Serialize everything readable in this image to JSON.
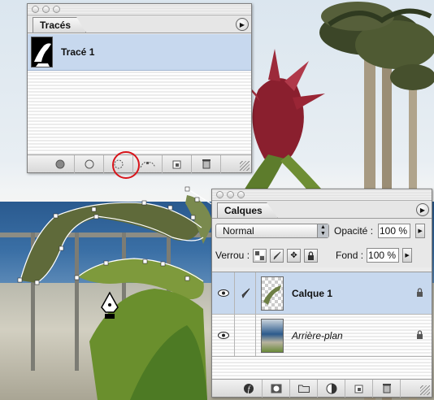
{
  "paths_panel": {
    "tab": "Tracés",
    "items": [
      {
        "label": "Tracé 1"
      }
    ],
    "buttons": [
      "fill-path-icon",
      "stroke-path-icon",
      "load-path-as-selection-icon",
      "make-work-path-icon",
      "new-path-icon",
      "trash-icon"
    ]
  },
  "layers_panel": {
    "tab": "Calques",
    "blend_mode": "Normal",
    "opacity_label": "Opacité :",
    "opacity_value": "100 %",
    "lock_label": "Verrou :",
    "fill_label": "Fond :",
    "fill_value": "100 %",
    "layers": [
      {
        "name": "Calque 1",
        "selected": true
      },
      {
        "name": "Arrière-plan",
        "selected": false
      }
    ],
    "buttons": [
      "layer-style-icon",
      "add-mask-icon",
      "new-group-icon",
      "adjustment-layer-icon",
      "new-layer-icon",
      "trash-icon"
    ]
  },
  "colors": {
    "selection": "#c7d8ee",
    "highlight_ring": "#d8141a"
  }
}
